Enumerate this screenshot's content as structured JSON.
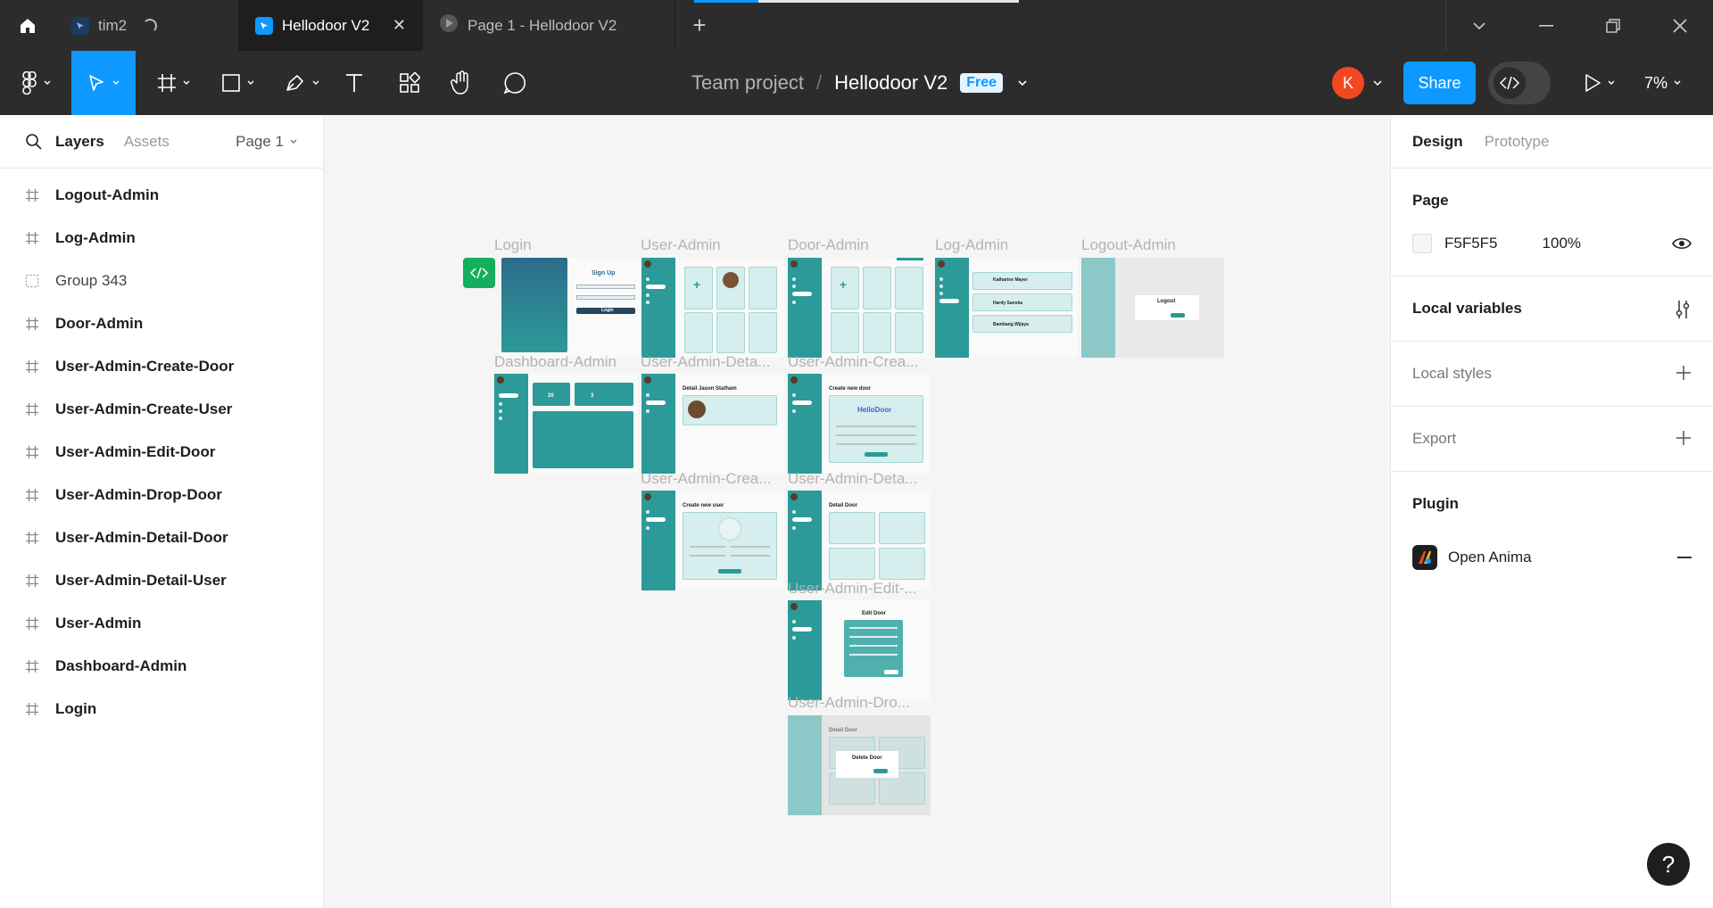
{
  "tabs": [
    {
      "label": "tim2",
      "loading": true
    },
    {
      "label": "Hellodoor V2",
      "active": true
    },
    {
      "label": "Page 1 - Hellodoor V2"
    }
  ],
  "toolbar": {
    "team": "Team project",
    "file_name": "Hellodoor V2",
    "plan_badge": "Free",
    "avatar_initial": "K",
    "share_label": "Share",
    "zoom": "7%"
  },
  "left_panel": {
    "tab_layers": "Layers",
    "tab_assets": "Assets",
    "page_selector": "Page 1",
    "layers": [
      {
        "name": "Logout-Admin",
        "type": "frame"
      },
      {
        "name": "Log-Admin",
        "type": "frame"
      },
      {
        "name": "Group 343",
        "type": "group"
      },
      {
        "name": "Door-Admin",
        "type": "frame"
      },
      {
        "name": "User-Admin-Create-Door",
        "type": "frame"
      },
      {
        "name": "User-Admin-Create-User",
        "type": "frame"
      },
      {
        "name": "User-Admin-Edit-Door",
        "type": "frame"
      },
      {
        "name": "User-Admin-Drop-Door",
        "type": "frame"
      },
      {
        "name": "User-Admin-Detail-Door",
        "type": "frame"
      },
      {
        "name": "User-Admin-Detail-User",
        "type": "frame"
      },
      {
        "name": "User-Admin",
        "type": "frame"
      },
      {
        "name": "Dashboard-Admin",
        "type": "frame"
      },
      {
        "name": "Login",
        "type": "frame"
      }
    ]
  },
  "canvas": {
    "frame_labels": {
      "login": "Login",
      "user_admin": "User-Admin",
      "door_admin": "Door-Admin",
      "log_admin": "Log-Admin",
      "logout_admin": "Logout-Admin",
      "dashboard_admin": "Dashboard-Admin",
      "detail_user": "User-Admin-Deta...",
      "create_door": "User-Admin-Crea...",
      "create_user": "User-Admin-Crea...",
      "detail_door": "User-Admin-Deta...",
      "edit_door": "User-Admin-Edit-...",
      "drop_door": "User-Admin-Dro..."
    },
    "mock_text": {
      "sign_up": "Sign Up",
      "login_btn": "Login",
      "detail_jason": "Detail Jason Statham",
      "create_new_door": "Create new door",
      "hellodoor_logo": "HelloDoor",
      "create_new_user": "Create new user",
      "detail_door": "Detail Door",
      "edit_door": "Edit Door",
      "delete_door": "Delete Door",
      "logout": "Logout",
      "dash_num_1": "20",
      "dash_num_2": "3",
      "log_name_1": "Katharine Mayer",
      "log_name_2": "Hardy Sanska",
      "log_name_3": "Bambang Wijaya"
    }
  },
  "right_panel": {
    "tab_design": "Design",
    "tab_prototype": "Prototype",
    "page_section": "Page",
    "page_color": "F5F5F5",
    "page_opacity": "100%",
    "local_variables": "Local variables",
    "local_styles": "Local styles",
    "export": "Export",
    "plugin_section": "Plugin",
    "plugin_name": "Open Anima"
  },
  "help_label": "?"
}
